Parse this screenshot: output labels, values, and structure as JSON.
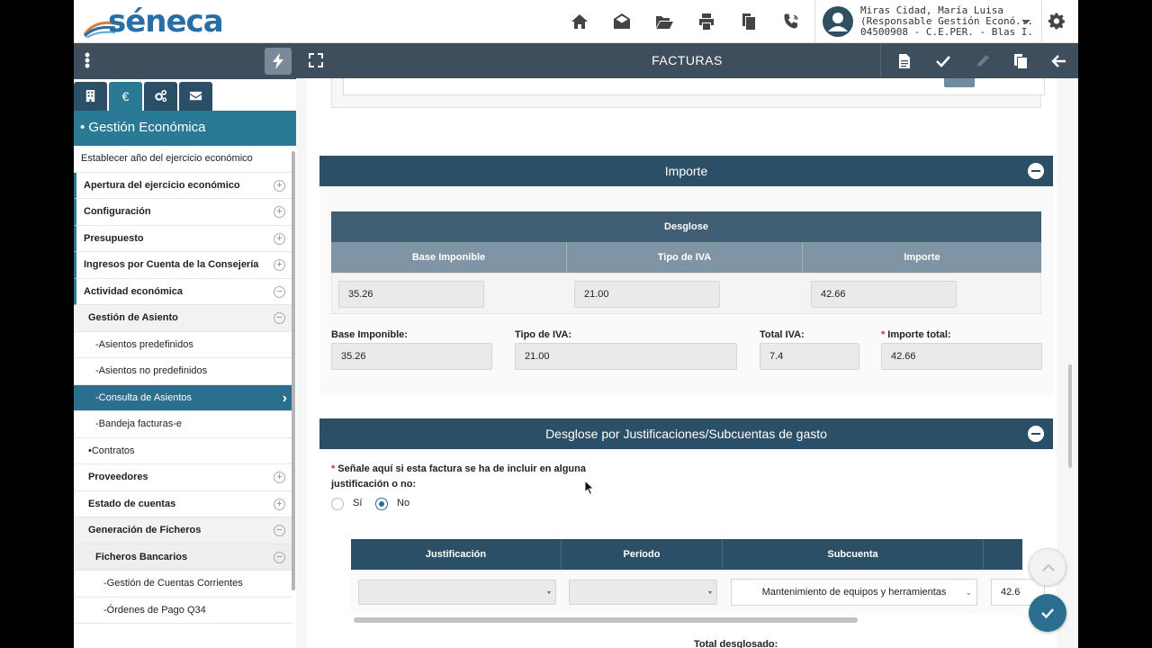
{
  "app": {
    "logo_text": "séneca"
  },
  "user": {
    "name": "Miras Cidad, María Luisa",
    "role": "(Responsable Gestión Econó...",
    "center": "04500908 - C.E.PER. - Blas I..."
  },
  "top_icons": [
    "home-icon",
    "envelope-open-icon",
    "folder-open-icon",
    "print-icon",
    "copy-icon",
    "phone-icon",
    "gear-icon"
  ],
  "sidebar": {
    "tabs": [
      {
        "name": "building-icon",
        "label": ""
      },
      {
        "name": "euro-icon",
        "label": "€"
      },
      {
        "name": "cogs-icon",
        "label": ""
      },
      {
        "name": "envelope-icon",
        "label": ""
      }
    ],
    "section_title": "• Gestión Económica",
    "items": [
      {
        "label": "Establecer año del ejercicio económico"
      },
      {
        "label": "Apertura del ejercicio económico"
      },
      {
        "label": "Configuración"
      },
      {
        "label": "Presupuesto"
      },
      {
        "label": "Ingresos por Cuenta de la Consejería"
      },
      {
        "label": "Actividad económica"
      },
      {
        "label": "Gestión de Asiento"
      },
      {
        "label": "-Asientos predefinidos"
      },
      {
        "label": "-Asientos no predefinidos"
      },
      {
        "label": "-Consulta de Asientos"
      },
      {
        "label": "-Bandeja facturas-e"
      },
      {
        "label": "•Contratos"
      },
      {
        "label": "Proveedores"
      },
      {
        "label": "Estado de cuentas"
      },
      {
        "label": "Generación de Ficheros"
      },
      {
        "label": "Ficheros Bancarios"
      },
      {
        "label": "-Gestión de Cuentas Corrientes"
      },
      {
        "label": "-Órdenes de Pago Q34"
      }
    ]
  },
  "content": {
    "title": "FACTURAS",
    "importe_panel": {
      "title": "Importe",
      "desglose_title": "Desglose",
      "columns": [
        "Base Imponible",
        "Tipo de IVA",
        "Importe"
      ],
      "row": [
        "35.26",
        "21.00",
        "42.66"
      ],
      "fields": {
        "base_label": "Base Imponible:",
        "base_value": "35.26",
        "tipo_label": "Tipo de IVA:",
        "tipo_value": "21.00",
        "total_iva_label": "Total IVA:",
        "total_iva_value": "7.4",
        "importe_total_label": "Importe total:",
        "importe_total_value": "42.66",
        "required_mark": "*"
      }
    },
    "justif_panel": {
      "title": "Desglose por Justificaciones/Subcuentas de gasto",
      "question_line1": "Señale aquí si esta factura se ha de incluir en alguna",
      "question_line2": "justificación o no:",
      "option_yes": "Sí",
      "option_no": "No",
      "selected": "No",
      "columns": [
        "Justificación",
        "Período",
        "Subcuenta"
      ],
      "subcuenta_value": "Mantenimiento de equipos y herramientas",
      "amount_value": "42.6",
      "total_label": "Total desglosado:"
    }
  },
  "colors": {
    "header_dark": "#3f4e5c",
    "panel_blue": "#2b4f66",
    "accent_teal": "#2b7a95",
    "selected_item": "#2b6f8e"
  }
}
